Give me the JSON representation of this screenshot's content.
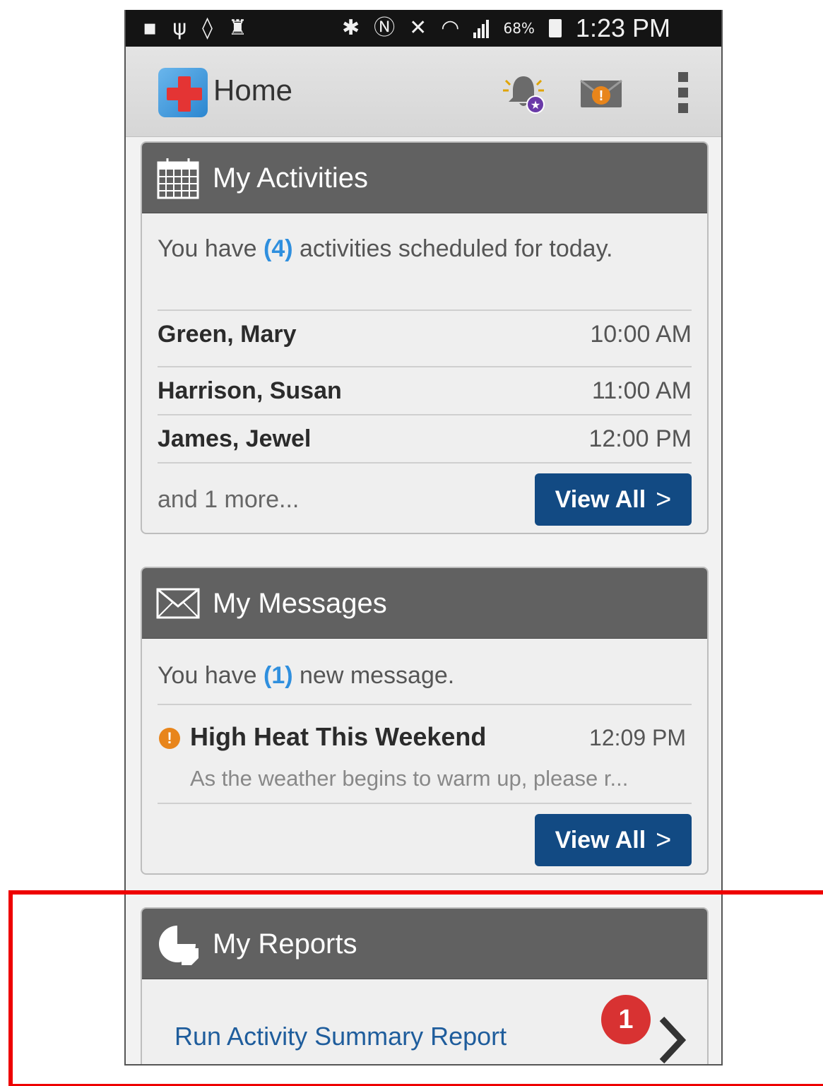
{
  "status_bar": {
    "battery_pct": "68%",
    "time": "1:23 PM",
    "icons": [
      "screenshot-icon",
      "usb-icon",
      "location-icon",
      "keyhole-icon",
      "bluetooth-icon",
      "nfc-icon",
      "mute-icon",
      "wifi-icon",
      "signal-icon",
      "battery-icon"
    ]
  },
  "action_bar": {
    "title": "Home",
    "icons": [
      "app-logo-icon",
      "alarm-bell-icon",
      "mail-alert-icon",
      "overflow-menu-icon"
    ]
  },
  "activities": {
    "header": "My Activities",
    "intro_pre": "You have ",
    "count": "(4)",
    "intro_post": " activities scheduled for today.",
    "rows": [
      {
        "name": "Green, Mary",
        "time": "10:00 AM"
      },
      {
        "name": "Harrison, Susan",
        "time": "11:00 AM"
      },
      {
        "name": "James, Jewel",
        "time": "12:00 PM"
      }
    ],
    "more": "and 1 more...",
    "view_all": "View All"
  },
  "messages": {
    "header": "My Messages",
    "intro_pre": "You have ",
    "count": "(1)",
    "intro_post": " new message.",
    "item": {
      "alert": "!",
      "subject": "High Heat This Weekend",
      "time": "12:09 PM",
      "preview": "As the weather begins to warm up, please r..."
    },
    "view_all": "View All"
  },
  "reports": {
    "header": "My Reports",
    "link": "Run Activity Summary Report",
    "badge": "1"
  },
  "colors": {
    "card_header": "#616161",
    "button": "#124a83",
    "count_blue": "#2f8fde",
    "badge_red": "#d83232",
    "alert_orange": "#e8851b",
    "highlight": "#ee0000"
  }
}
